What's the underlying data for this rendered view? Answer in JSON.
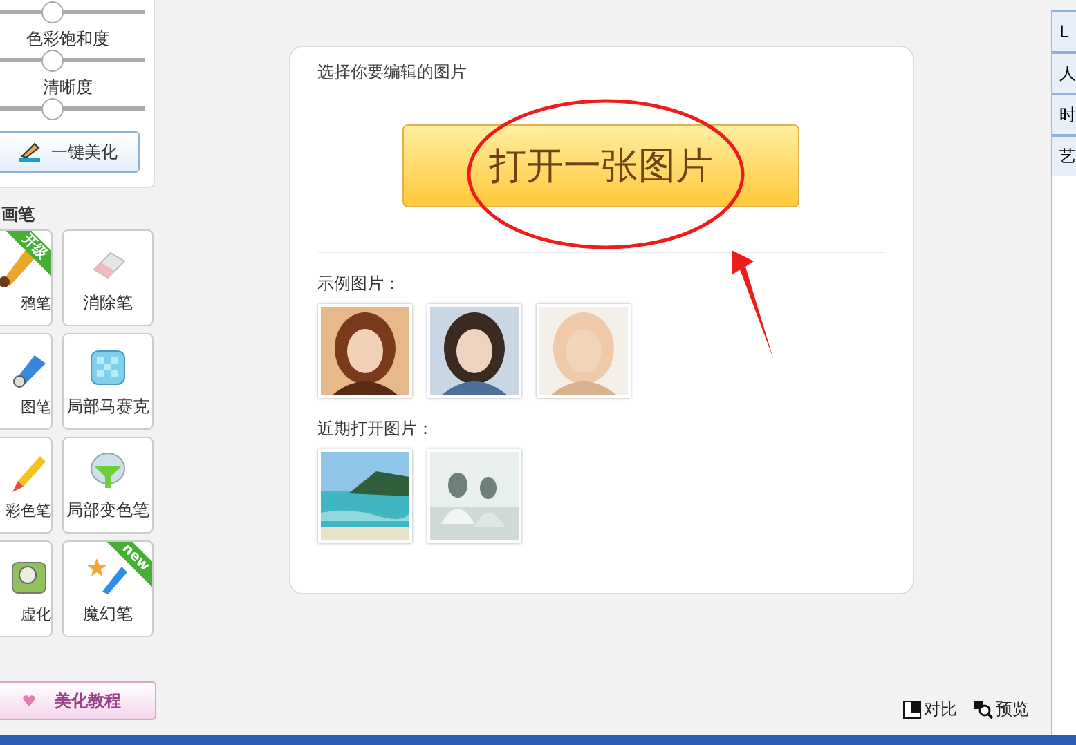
{
  "adjustments": [
    {
      "level": 0.38
    },
    {
      "label": "色彩饱和度",
      "level": 0.38
    },
    {
      "label": "清晰度",
      "level": 0.38
    }
  ],
  "one_click_button": "一键美化",
  "brush_section": {
    "title": "画笔",
    "tools": [
      {
        "label": "鸦笔",
        "ribbon": "开级"
      },
      {
        "label": "消除笔"
      },
      {
        "label": "图笔"
      },
      {
        "label": "局部马赛克"
      },
      {
        "label": "彩色笔"
      },
      {
        "label": "局部变色笔"
      },
      {
        "label": "虚化"
      },
      {
        "label": "魔幻笔",
        "ribbon": "new"
      }
    ]
  },
  "tutorial_button": "美化教程",
  "main_card": {
    "prompt": "选择你要编辑的图片",
    "open_button": "打开一张图片",
    "samples_label": "示例图片：",
    "recent_label": "近期打开图片："
  },
  "right_tabs": [
    {
      "label": "L"
    },
    {
      "label": "人"
    },
    {
      "label": "时"
    },
    {
      "label": "艺"
    }
  ],
  "footer": {
    "compare": "对比",
    "preview": "预览"
  }
}
